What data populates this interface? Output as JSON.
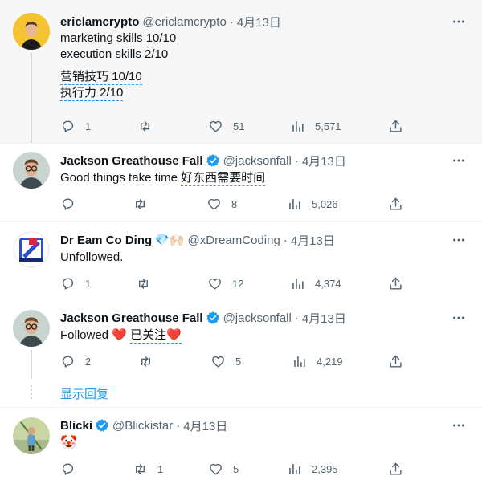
{
  "tweets": [
    {
      "name": "ericlamcrypto",
      "handle": "@ericlamcrypto",
      "dot": "·",
      "date": "4月13日",
      "lines": [
        "marketing skills 10/10",
        "execution skills 2/10"
      ],
      "translation": [
        "营销技巧 10/10",
        "执行力 2/10"
      ],
      "replies": "1",
      "retweets": "",
      "likes": "51",
      "views": "5,571"
    },
    {
      "name": "Jackson Greathouse Fall",
      "handle": "@jacksonfall",
      "dot": "·",
      "date": "4月13日",
      "text": "Good things take time ",
      "translation": "好东西需要时间",
      "replies": "",
      "retweets": "",
      "likes": "8",
      "views": "5,026"
    },
    {
      "name": "Dr Eam Co Ding",
      "name_emoji": "💎🙌🏻",
      "handle": "@xDreamCoding",
      "dot": "·",
      "date": "4月13日",
      "text": "Unfollowed.",
      "replies": "1",
      "retweets": "",
      "likes": "12",
      "views": "4,374"
    },
    {
      "name": "Jackson Greathouse Fall",
      "handle": "@jacksonfall",
      "dot": "·",
      "date": "4月13日",
      "text": "Followed ",
      "heart": "❤️",
      "translation": "已关注",
      "replies": "2",
      "retweets": "",
      "likes": "5",
      "views": "4,219"
    },
    {
      "name": "Blicki",
      "handle": "@Blickistar",
      "dot": "·",
      "date": "4月13日",
      "text": "🤡",
      "replies": "",
      "retweets": "1",
      "likes": "5",
      "views": "2,395"
    }
  ],
  "show_replies": "显示回复",
  "colors": {
    "accent": "#1d9bf0",
    "muted": "#536471",
    "text": "#0f1419",
    "heart": "#e0245e"
  },
  "icons": [
    "more-icon",
    "reply-icon",
    "retweet-icon",
    "like-icon",
    "views-icon",
    "share-icon",
    "verified-icon"
  ]
}
